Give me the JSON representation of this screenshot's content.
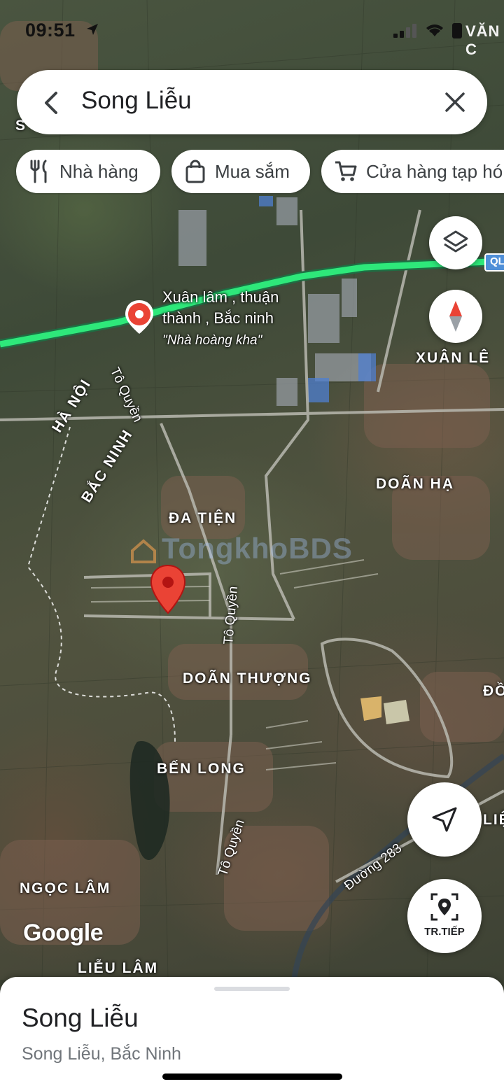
{
  "status_bar": {
    "time": "09:51",
    "corner_label": "VĂN C"
  },
  "search": {
    "query": "Song Liễu"
  },
  "chips": [
    {
      "label": "Nhà hàng",
      "icon": "fork-knife-icon"
    },
    {
      "label": "Mua sắm",
      "icon": "shopping-bag-icon"
    },
    {
      "label": "Cửa hàng tạp hó",
      "icon": "cart-icon"
    }
  ],
  "map": {
    "highway_badge": "QL",
    "places": {
      "xuan_le": "XUÂN LÊ",
      "doan_ha": "DOÃN HẠ",
      "da_tien": "ĐA TIỆN",
      "doan_thuong": "DOÃN THƯỢNG",
      "ben_long": "BẾN LONG",
      "ngoc_lam": "NGỌC LÂM",
      "lieu_lam": "LIỄU LÂM",
      "ha_noi": "HÀ NỘI",
      "bac_ninh": "BẮC NINH",
      "do_edge": "ĐỒ",
      "lie_edge": "LIỆ",
      "s_edge": "S"
    },
    "roads": {
      "to_quyen_1": "Tô Quyền",
      "to_quyen_2": "Tô Quyền",
      "to_quyen_3": "Tô Quyền",
      "duong_283": "Đường 283"
    },
    "poi": {
      "line1": "Xuân lâm , thuận",
      "line2": "thành , Bắc ninh",
      "subtitle": "\"Nhà hoàng kha\""
    },
    "watermark": "TongkhoBDS",
    "logo": "Google"
  },
  "controls": {
    "live_view_label": "TR.TIẾP"
  },
  "sheet": {
    "title": "Song Liễu",
    "subtitle": "Song Liễu, Bắc Ninh"
  },
  "colors": {
    "route": "#2ee87a",
    "pin": "#ea4335",
    "highway_badge": "#4f8fd8"
  }
}
